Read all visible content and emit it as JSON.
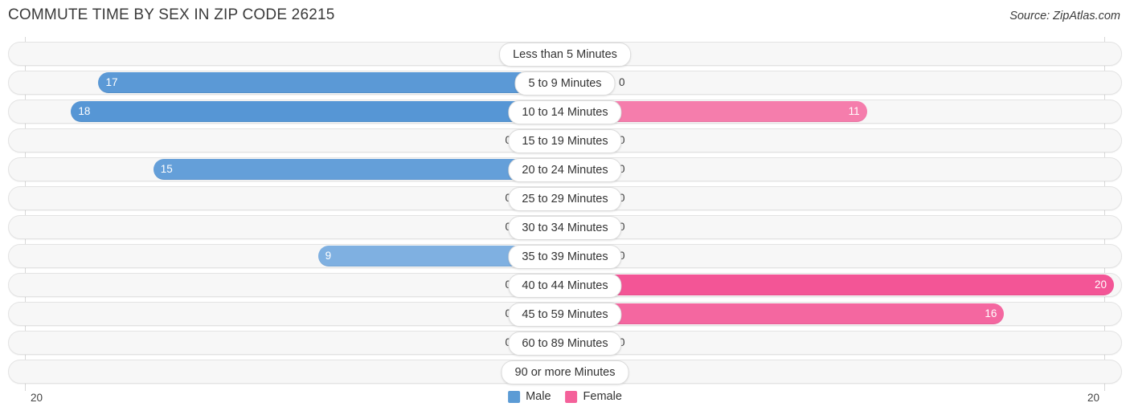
{
  "header": {
    "title": "COMMUTE TIME BY SEX IN ZIP CODE 26215",
    "source": "Source: ZipAtlas.com"
  },
  "legend": {
    "male_label": "Male",
    "female_label": "Female",
    "male_color": "#5b9bd5",
    "female_color": "#f4619a"
  },
  "axis": {
    "left_tick": "20",
    "right_tick": "20"
  },
  "chart_data": {
    "type": "bar",
    "title": "COMMUTE TIME BY SEX IN ZIP CODE 26215",
    "subtitle": "Source: ZipAtlas.com",
    "orientation": "horizontal",
    "style": "diverging back-to-back population pyramid",
    "xlabel": "",
    "ylabel": "",
    "xlim_left": [
      20,
      0
    ],
    "xlim_right": [
      0,
      20
    ],
    "grid": false,
    "legend_position": "bottom-center",
    "categories": [
      "Less than 5 Minutes",
      "5 to 9 Minutes",
      "10 to 14 Minutes",
      "15 to 19 Minutes",
      "20 to 24 Minutes",
      "25 to 29 Minutes",
      "30 to 34 Minutes",
      "35 to 39 Minutes",
      "40 to 44 Minutes",
      "45 to 59 Minutes",
      "60 to 89 Minutes",
      "90 or more Minutes"
    ],
    "series": [
      {
        "name": "Male",
        "values": [
          0,
          17,
          18,
          0,
          15,
          0,
          0,
          9,
          0,
          0,
          0,
          0
        ]
      },
      {
        "name": "Female",
        "values": [
          0,
          0,
          11,
          0,
          0,
          0,
          0,
          0,
          20,
          16,
          0,
          0
        ]
      }
    ]
  },
  "rows": [
    {
      "label": "Less than 5 Minutes",
      "male": "0",
      "female": "0"
    },
    {
      "label": "5 to 9 Minutes",
      "male": "17",
      "female": "0"
    },
    {
      "label": "10 to 14 Minutes",
      "male": "18",
      "female": "11"
    },
    {
      "label": "15 to 19 Minutes",
      "male": "0",
      "female": "0"
    },
    {
      "label": "20 to 24 Minutes",
      "male": "15",
      "female": "0"
    },
    {
      "label": "25 to 29 Minutes",
      "male": "0",
      "female": "0"
    },
    {
      "label": "30 to 34 Minutes",
      "male": "0",
      "female": "0"
    },
    {
      "label": "35 to 39 Minutes",
      "male": "9",
      "female": "0"
    },
    {
      "label": "40 to 44 Minutes",
      "male": "0",
      "female": "20"
    },
    {
      "label": "45 to 59 Minutes",
      "male": "0",
      "female": "16"
    },
    {
      "label": "60 to 89 Minutes",
      "male": "0",
      "female": "0"
    },
    {
      "label": "90 or more Minutes",
      "male": "0",
      "female": "0"
    }
  ]
}
